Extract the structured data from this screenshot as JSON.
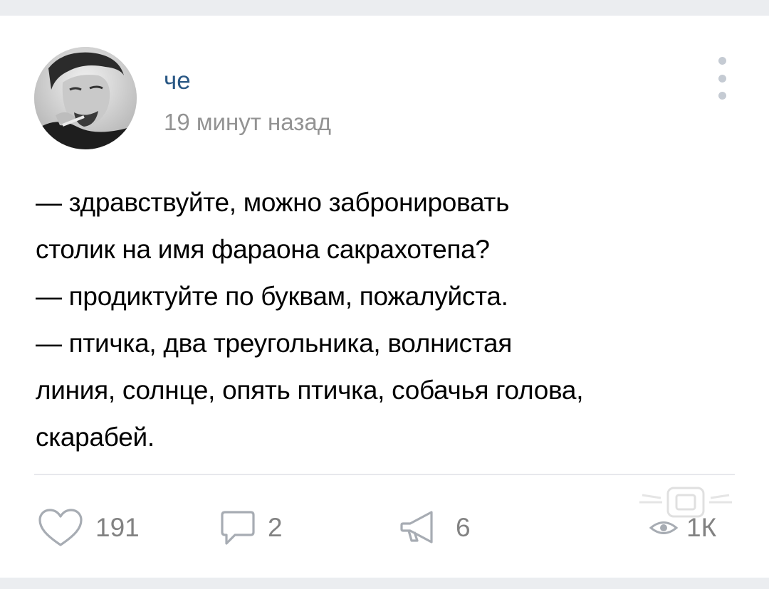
{
  "post": {
    "author": "че",
    "time": "19 минут назад",
    "text_lines": [
      "— здравствуйте, можно забронировать",
      "столик на имя фараона сакрахотепа?",
      "— продиктуйте по буквам, пожалуйста.",
      "— птичка, два треугольника, волнистая",
      "линия, солнце, опять птичка, собачья голова,",
      "скарабей."
    ]
  },
  "actions": {
    "likes": "191",
    "comments": "2",
    "shares": "6",
    "views": "1К"
  },
  "icons": {
    "avatar": "user-avatar-photo",
    "more": "more-vertical-icon",
    "like": "heart-icon",
    "comment": "comment-icon",
    "share": "share-megaphone-icon",
    "views": "eye-icon",
    "watermark": "watermark-logo"
  },
  "colors": {
    "author": "#2a5885",
    "muted": "#939393",
    "icon": "#828282",
    "background": "#ebedf0"
  }
}
